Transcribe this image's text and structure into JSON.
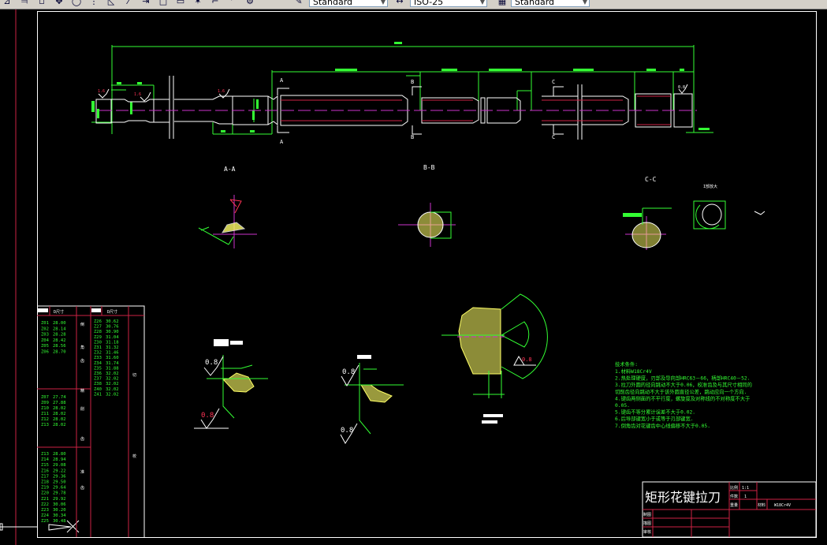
{
  "toolbar": {
    "text_style": "Standard",
    "dim_style": "ISO-25",
    "table_style": "Standard",
    "icons": [
      "mirror-icon",
      "offset-icon",
      "array-icon",
      "move-icon",
      "rotate-icon",
      "scale-icon",
      "stretch-icon",
      "trim-icon",
      "extend-icon",
      "break-icon",
      "break-at-point-icon",
      "explode-icon",
      "chamfer-icon",
      "fillet-icon",
      "properties-icon"
    ]
  },
  "colors": {
    "background": "#000000",
    "outline": "#ffffff",
    "dimension": "#33ff33",
    "centerline": "#cc33cc",
    "border": "#cc2244",
    "hatch": "#ffff66",
    "roughness_red": "#ff3355"
  },
  "main_view": {
    "section_marks": [
      "A",
      "A",
      "B",
      "B",
      "C",
      "C"
    ],
    "roughness": [
      "1.6",
      "1.6",
      "1.6",
      "0.8"
    ]
  },
  "sections": {
    "aa_title": "A-A",
    "bb_title": "B-B",
    "cc_title": "C-C",
    "detail_title": "I部放大"
  },
  "details": {
    "roughness": [
      "0.8",
      "0.8",
      "0.8",
      "0.8",
      "0.8"
    ]
  },
  "tech_requirements": {
    "title": "技术条件:",
    "lines": [
      "1.材料W18Cr4V",
      "2.热处理硬度，刃部及导向部HRC63－66，柄部HRC40－52.",
      "3.拉刀外圆的径向跳动不大于0.06，校准齿及与其尺寸相同的",
      "  切削齿径向跳动不大于该外圆直径公差，跳动应向一个方向.",
      "4.键齿两侧面的不平行度，螺旋度及对称线的不对称度不大于",
      "0.05.",
      "5.键齿不等分累计误差不大于0.02.",
      "6.后导部键宽小于或等于刃部键宽.",
      "7.倒角齿对花键齿中心线偏移不大于0.05."
    ]
  },
  "tooth_table": {
    "header": "D尺寸",
    "col1_group1": [
      [
        "Z01",
        "28.00"
      ],
      [
        "Z02",
        "28.14"
      ],
      [
        "Z03",
        "28.28"
      ],
      [
        "Z04",
        "28.42"
      ],
      [
        "Z05",
        "28.56"
      ],
      [
        "Z06",
        "28.70"
      ]
    ],
    "col1_group2": [
      [
        "Z07",
        "27.74"
      ],
      [
        "Z09",
        "27.88"
      ],
      [
        "Z10",
        "28.02"
      ],
      [
        "Z11",
        "28.02"
      ],
      [
        "Z12",
        "28.02"
      ],
      [
        "Z13",
        "28.02"
      ]
    ],
    "col1_group3": [
      [
        "Z13",
        "28.80"
      ],
      [
        "Z14",
        "28.94"
      ],
      [
        "Z15",
        "29.08"
      ],
      [
        "Z16",
        "29.22"
      ],
      [
        "Z17",
        "29.36"
      ],
      [
        "Z18",
        "29.50"
      ],
      [
        "Z19",
        "29.64"
      ],
      [
        "Z20",
        "29.78"
      ],
      [
        "Z21",
        "29.92"
      ],
      [
        "Z22",
        "30.06"
      ],
      [
        "Z23",
        "30.20"
      ],
      [
        "Z24",
        "30.34"
      ],
      [
        "Z25",
        "30.48"
      ]
    ],
    "col2": [
      [
        "Z26",
        "30.62"
      ],
      [
        "Z27",
        "30.76"
      ],
      [
        "Z28",
        "30.90"
      ],
      [
        "Z29",
        "31.04"
      ],
      [
        "Z30",
        "31.18"
      ],
      [
        "Z31",
        "31.32"
      ],
      [
        "Z32",
        "31.46"
      ],
      [
        "Z33",
        "31.60"
      ],
      [
        "Z34",
        "31.74"
      ],
      [
        "Z35",
        "31.88"
      ],
      [
        "Z36",
        "32.02"
      ],
      [
        "Z37",
        "32.02"
      ],
      [
        "Z38",
        "32.02"
      ],
      [
        "Z40",
        "32.02"
      ],
      [
        "Z41",
        "32.02"
      ]
    ],
    "side_labels": [
      "倒",
      "角",
      "齿",
      "切",
      "削",
      "齿",
      "校",
      "准",
      "齿",
      "精"
    ]
  },
  "title_block": {
    "title": "矩形花键拉刀",
    "scale_label": "比例",
    "scale_value": "1:1",
    "count_label": "件数",
    "count_value": "1",
    "weight_label": "重量",
    "material_label": "材料",
    "material_value": "W18Cr4V",
    "drawn_label": "制图",
    "traced_label": "描图",
    "checked_label": "审核"
  }
}
